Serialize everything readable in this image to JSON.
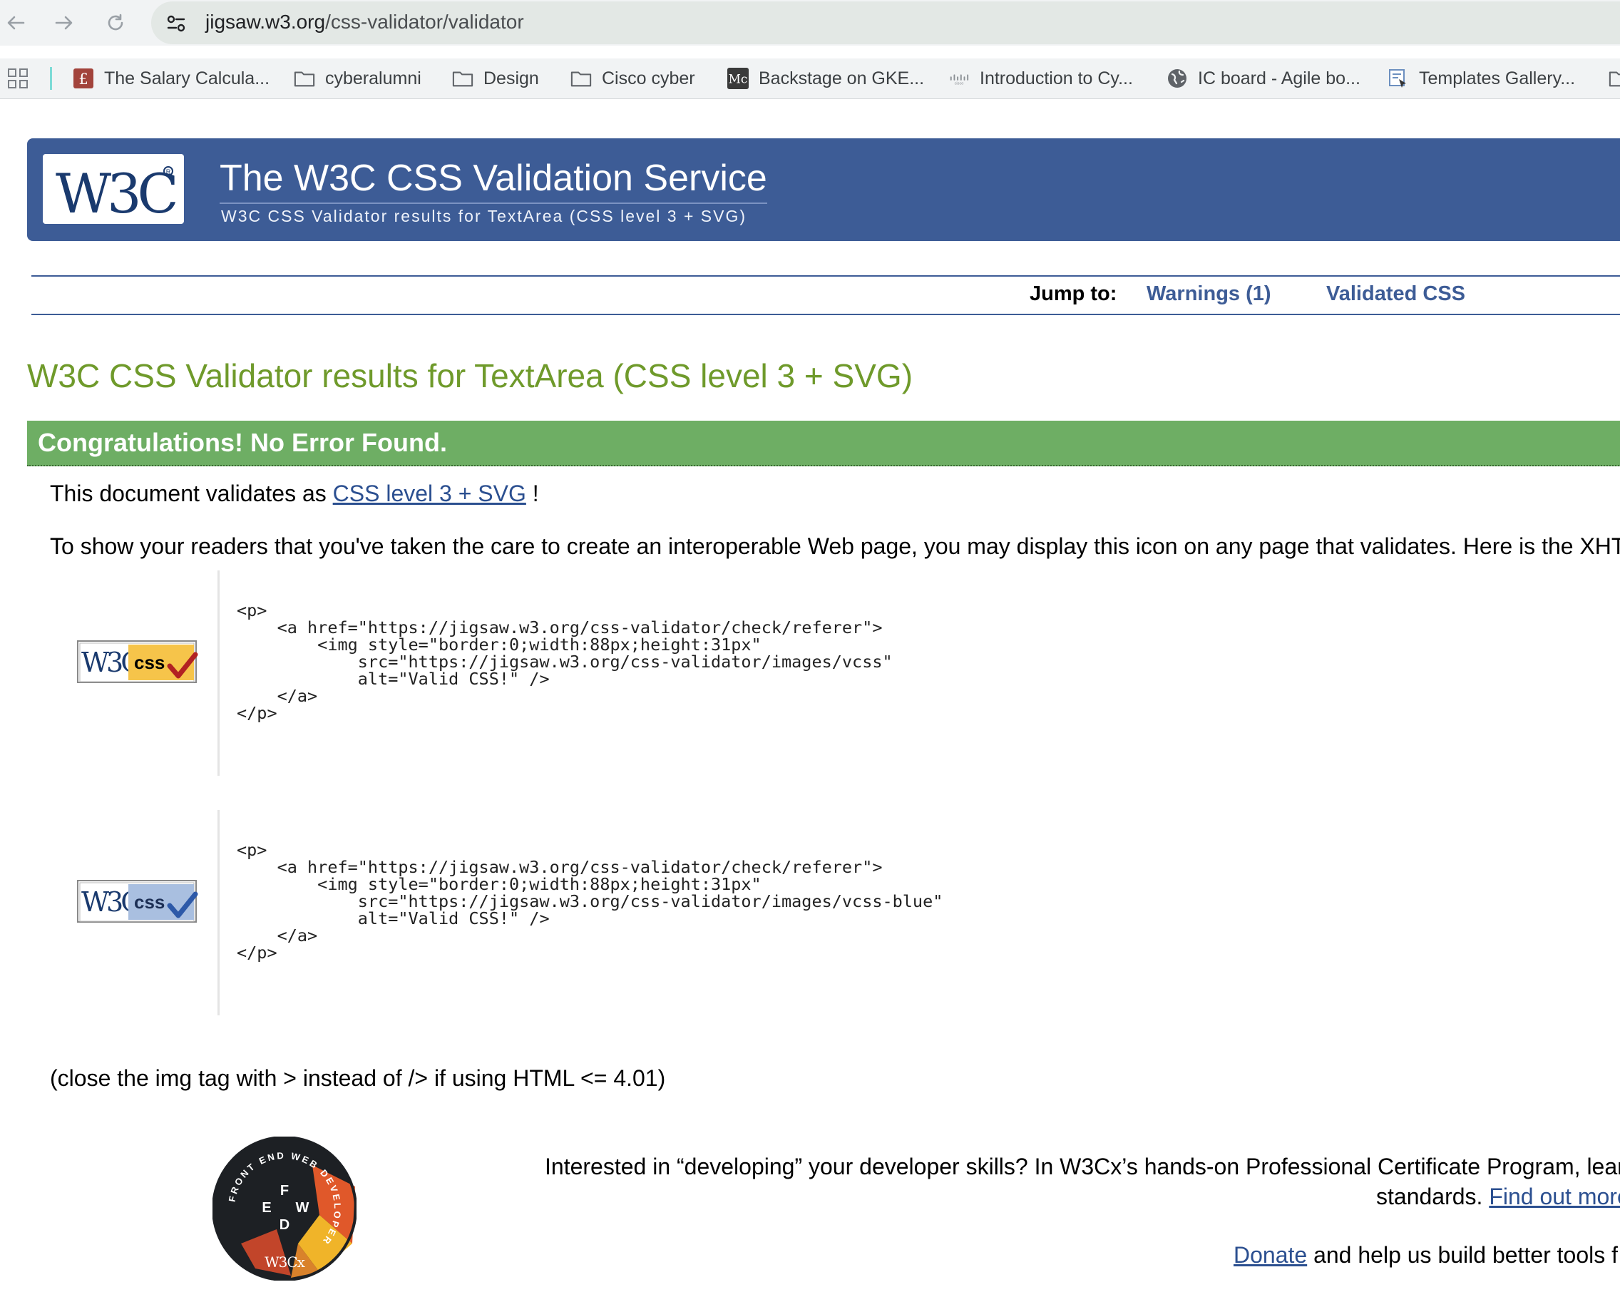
{
  "browser": {
    "url_host": "jigsaw.w3.org",
    "url_path": "/css-validator/validator",
    "bookmarks": [
      {
        "label": "The Salary Calcula...",
        "icon": "pound-icon"
      },
      {
        "label": "cyberalumni",
        "icon": "folder-icon"
      },
      {
        "label": "Design",
        "icon": "folder-icon"
      },
      {
        "label": "Cisco cyber",
        "icon": "folder-icon"
      },
      {
        "label": "Backstage on GKE...",
        "icon": "medium-icon"
      },
      {
        "label": "Introduction to Cy...",
        "icon": "cisco-icon"
      },
      {
        "label": "IC board - Agile bo...",
        "icon": "globe-icon"
      },
      {
        "label": "Templates Gallery...",
        "icon": "template-icon"
      }
    ]
  },
  "header": {
    "logo_text": "W3C",
    "title": "The W3C CSS Validation Service",
    "subtitle": "W3C CSS Validator results for TextArea (CSS level 3 + SVG)"
  },
  "jump": {
    "label": "Jump to:",
    "warnings": "Warnings (1)",
    "validated": "Validated CSS"
  },
  "results": {
    "title": "W3C CSS Validator results for TextArea (CSS level 3 + SVG)",
    "congrats": "Congratulations! No Error Found.",
    "validates_prefix": "This document validates as",
    "validates_link": "CSS level 3 + SVG",
    "validates_suffix": "!",
    "show_readers": "To show your readers that you've taken the care to create an interoperable Web page, you may display this icon on any page that validates. Here is the XHT",
    "code_gold": "<p>\n    <a href=\"https://jigsaw.w3.org/css-validator/check/referer\">\n        <img style=\"border:0;width:88px;height:31px\"\n            src=\"https://jigsaw.w3.org/css-validator/images/vcss\"\n            alt=\"Valid CSS!\" />\n    </a>\n</p>",
    "code_blue": "<p>\n    <a href=\"https://jigsaw.w3.org/css-validator/check/referer\">\n        <img style=\"border:0;width:88px;height:31px\"\n            src=\"https://jigsaw.w3.org/css-validator/images/vcss-blue\"\n            alt=\"Valid CSS!\" />\n    </a>\n</p>",
    "badge_logo": "W3C",
    "badge_text": "css",
    "close_note": "(close the img tag with > instead of /> if using HTML <= 4.01)"
  },
  "promo": {
    "line1": "Interested in “developing” your developer skills? In W3Cx’s hands-on Professional Certificate Program, lear",
    "line2_prefix": "standards.",
    "line2_link": "Find out more",
    "donate_link": "Donate",
    "donate_suffix": "and help us build better tools f",
    "badge_brand": "W3Cx",
    "badge_ring_text": "FRONT END WEB DEVELOPER",
    "badge_letters": [
      "F",
      "E",
      "W",
      "D"
    ]
  },
  "colors": {
    "header_blue": "#3d5c96",
    "results_green": "#6f9a2b",
    "congrats_green": "#6eae64",
    "link_blue": "#2b4f90"
  }
}
